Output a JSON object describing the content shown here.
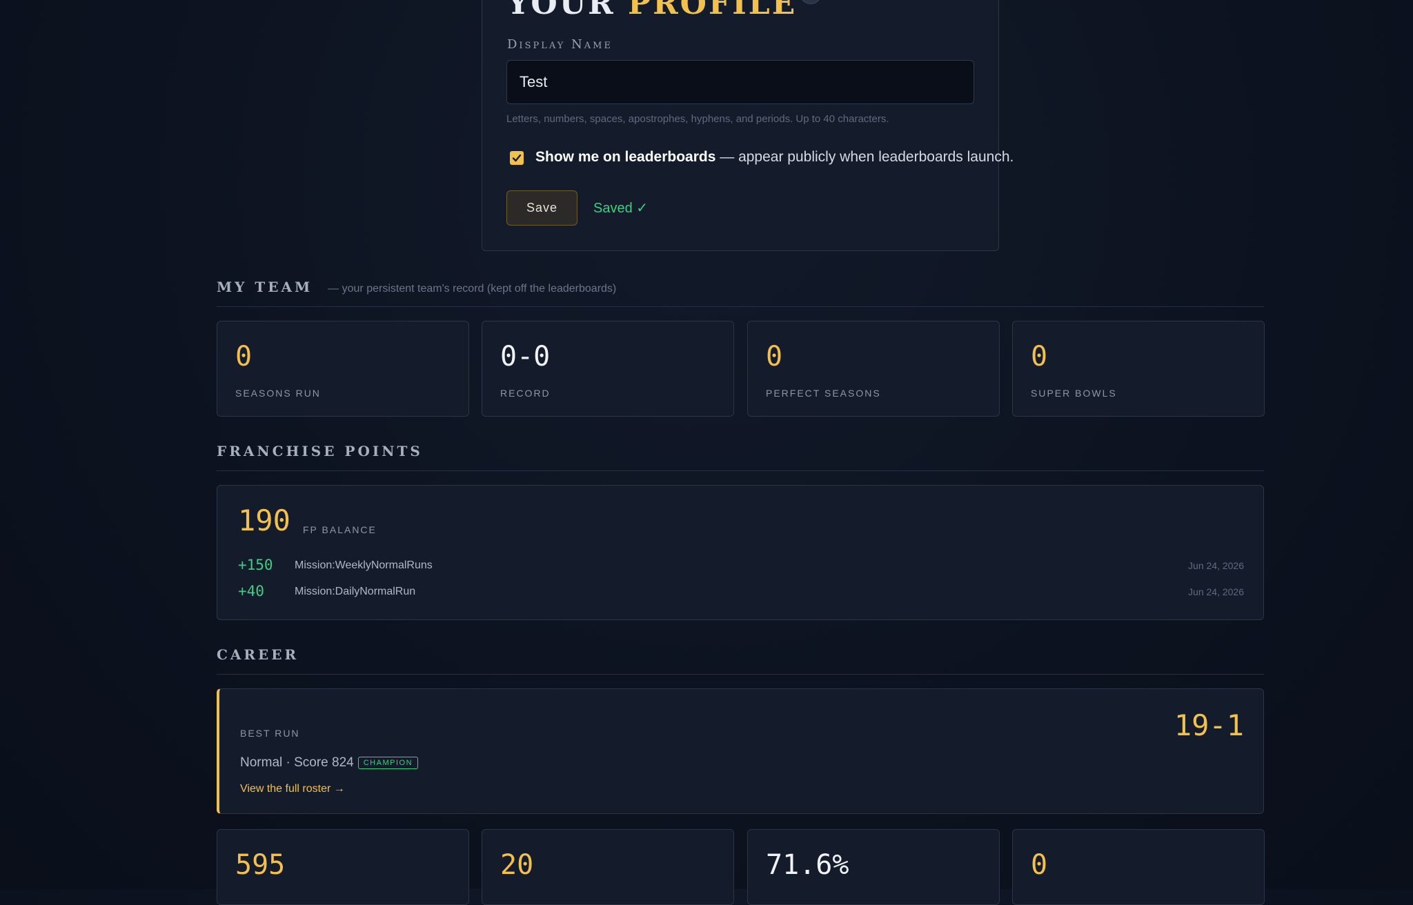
{
  "profile": {
    "title_part1": "YOUR ",
    "title_part2": "PROFILE",
    "display_name_label": "Display Name",
    "display_name_value": "Test",
    "help_text": "Letters, numbers, spaces, apostrophes, hyphens, and periods. Up to 40 characters.",
    "leaderboard_checkbox_checked": true,
    "leaderboard_label_bold": "Show me on leaderboards",
    "leaderboard_label_rest": " — appear publicly when leaderboards launch.",
    "save_label": "Save",
    "saved_status": "Saved ✓"
  },
  "my_team": {
    "heading": "MY TEAM",
    "subheading": "— your persistent team's record (kept off the leaderboards)",
    "stats": [
      {
        "value": "0",
        "label": "SEASONS RUN",
        "color": "#f2c04d"
      },
      {
        "value": "0-0",
        "label": "RECORD",
        "color": "#f1f3f7"
      },
      {
        "value": "0",
        "label": "PERFECT SEASONS",
        "color": "#f2c04d"
      },
      {
        "value": "0",
        "label": "SUPER BOWLS",
        "color": "#f2c04d"
      }
    ]
  },
  "franchise_points": {
    "heading": "FRANCHISE POINTS",
    "balance": "190",
    "balance_label": "FP BALANCE",
    "transactions": [
      {
        "amount": "+150",
        "description": "Mission:WeeklyNormalRuns",
        "date": "Jun 24, 2026"
      },
      {
        "amount": "+40",
        "description": "Mission:DailyNormalRun",
        "date": "Jun 24, 2026"
      }
    ]
  },
  "career": {
    "heading": "CAREER",
    "best_run_label": "BEST RUN",
    "best_run_record": "19-1",
    "best_run_detail": "Normal · Score 824",
    "best_run_badge": "CHAMPION",
    "roster_link": "View the full roster →",
    "stats": [
      {
        "value": "595",
        "color": "#f2c04d"
      },
      {
        "value": "20",
        "color": "#f2c04d"
      },
      {
        "value": "71.6%",
        "color": "#f1f3f7"
      },
      {
        "value": "0",
        "color": "#f2c04d"
      }
    ]
  },
  "colors": {
    "accent": "#f2c04d",
    "success": "#3ecf7e",
    "background": "#0c121f",
    "card": "#141c2c"
  }
}
